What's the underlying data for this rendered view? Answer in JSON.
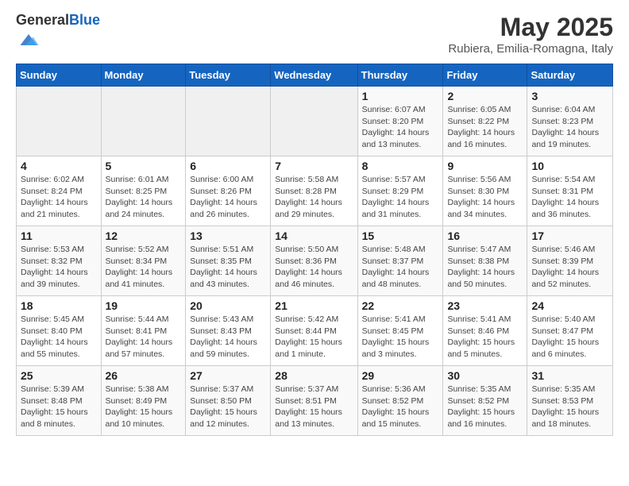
{
  "header": {
    "logo_general": "General",
    "logo_blue": "Blue",
    "month": "May 2025",
    "location": "Rubiera, Emilia-Romagna, Italy"
  },
  "weekdays": [
    "Sunday",
    "Monday",
    "Tuesday",
    "Wednesday",
    "Thursday",
    "Friday",
    "Saturday"
  ],
  "weeks": [
    [
      {
        "day": "",
        "info": ""
      },
      {
        "day": "",
        "info": ""
      },
      {
        "day": "",
        "info": ""
      },
      {
        "day": "",
        "info": ""
      },
      {
        "day": "1",
        "info": "Sunrise: 6:07 AM\nSunset: 8:20 PM\nDaylight: 14 hours\nand 13 minutes."
      },
      {
        "day": "2",
        "info": "Sunrise: 6:05 AM\nSunset: 8:22 PM\nDaylight: 14 hours\nand 16 minutes."
      },
      {
        "day": "3",
        "info": "Sunrise: 6:04 AM\nSunset: 8:23 PM\nDaylight: 14 hours\nand 19 minutes."
      }
    ],
    [
      {
        "day": "4",
        "info": "Sunrise: 6:02 AM\nSunset: 8:24 PM\nDaylight: 14 hours\nand 21 minutes."
      },
      {
        "day": "5",
        "info": "Sunrise: 6:01 AM\nSunset: 8:25 PM\nDaylight: 14 hours\nand 24 minutes."
      },
      {
        "day": "6",
        "info": "Sunrise: 6:00 AM\nSunset: 8:26 PM\nDaylight: 14 hours\nand 26 minutes."
      },
      {
        "day": "7",
        "info": "Sunrise: 5:58 AM\nSunset: 8:28 PM\nDaylight: 14 hours\nand 29 minutes."
      },
      {
        "day": "8",
        "info": "Sunrise: 5:57 AM\nSunset: 8:29 PM\nDaylight: 14 hours\nand 31 minutes."
      },
      {
        "day": "9",
        "info": "Sunrise: 5:56 AM\nSunset: 8:30 PM\nDaylight: 14 hours\nand 34 minutes."
      },
      {
        "day": "10",
        "info": "Sunrise: 5:54 AM\nSunset: 8:31 PM\nDaylight: 14 hours\nand 36 minutes."
      }
    ],
    [
      {
        "day": "11",
        "info": "Sunrise: 5:53 AM\nSunset: 8:32 PM\nDaylight: 14 hours\nand 39 minutes."
      },
      {
        "day": "12",
        "info": "Sunrise: 5:52 AM\nSunset: 8:34 PM\nDaylight: 14 hours\nand 41 minutes."
      },
      {
        "day": "13",
        "info": "Sunrise: 5:51 AM\nSunset: 8:35 PM\nDaylight: 14 hours\nand 43 minutes."
      },
      {
        "day": "14",
        "info": "Sunrise: 5:50 AM\nSunset: 8:36 PM\nDaylight: 14 hours\nand 46 minutes."
      },
      {
        "day": "15",
        "info": "Sunrise: 5:48 AM\nSunset: 8:37 PM\nDaylight: 14 hours\nand 48 minutes."
      },
      {
        "day": "16",
        "info": "Sunrise: 5:47 AM\nSunset: 8:38 PM\nDaylight: 14 hours\nand 50 minutes."
      },
      {
        "day": "17",
        "info": "Sunrise: 5:46 AM\nSunset: 8:39 PM\nDaylight: 14 hours\nand 52 minutes."
      }
    ],
    [
      {
        "day": "18",
        "info": "Sunrise: 5:45 AM\nSunset: 8:40 PM\nDaylight: 14 hours\nand 55 minutes."
      },
      {
        "day": "19",
        "info": "Sunrise: 5:44 AM\nSunset: 8:41 PM\nDaylight: 14 hours\nand 57 minutes."
      },
      {
        "day": "20",
        "info": "Sunrise: 5:43 AM\nSunset: 8:43 PM\nDaylight: 14 hours\nand 59 minutes."
      },
      {
        "day": "21",
        "info": "Sunrise: 5:42 AM\nSunset: 8:44 PM\nDaylight: 15 hours\nand 1 minute."
      },
      {
        "day": "22",
        "info": "Sunrise: 5:41 AM\nSunset: 8:45 PM\nDaylight: 15 hours\nand 3 minutes."
      },
      {
        "day": "23",
        "info": "Sunrise: 5:41 AM\nSunset: 8:46 PM\nDaylight: 15 hours\nand 5 minutes."
      },
      {
        "day": "24",
        "info": "Sunrise: 5:40 AM\nSunset: 8:47 PM\nDaylight: 15 hours\nand 6 minutes."
      }
    ],
    [
      {
        "day": "25",
        "info": "Sunrise: 5:39 AM\nSunset: 8:48 PM\nDaylight: 15 hours\nand 8 minutes."
      },
      {
        "day": "26",
        "info": "Sunrise: 5:38 AM\nSunset: 8:49 PM\nDaylight: 15 hours\nand 10 minutes."
      },
      {
        "day": "27",
        "info": "Sunrise: 5:37 AM\nSunset: 8:50 PM\nDaylight: 15 hours\nand 12 minutes."
      },
      {
        "day": "28",
        "info": "Sunrise: 5:37 AM\nSunset: 8:51 PM\nDaylight: 15 hours\nand 13 minutes."
      },
      {
        "day": "29",
        "info": "Sunrise: 5:36 AM\nSunset: 8:52 PM\nDaylight: 15 hours\nand 15 minutes."
      },
      {
        "day": "30",
        "info": "Sunrise: 5:35 AM\nSunset: 8:52 PM\nDaylight: 15 hours\nand 16 minutes."
      },
      {
        "day": "31",
        "info": "Sunrise: 5:35 AM\nSunset: 8:53 PM\nDaylight: 15 hours\nand 18 minutes."
      }
    ]
  ]
}
